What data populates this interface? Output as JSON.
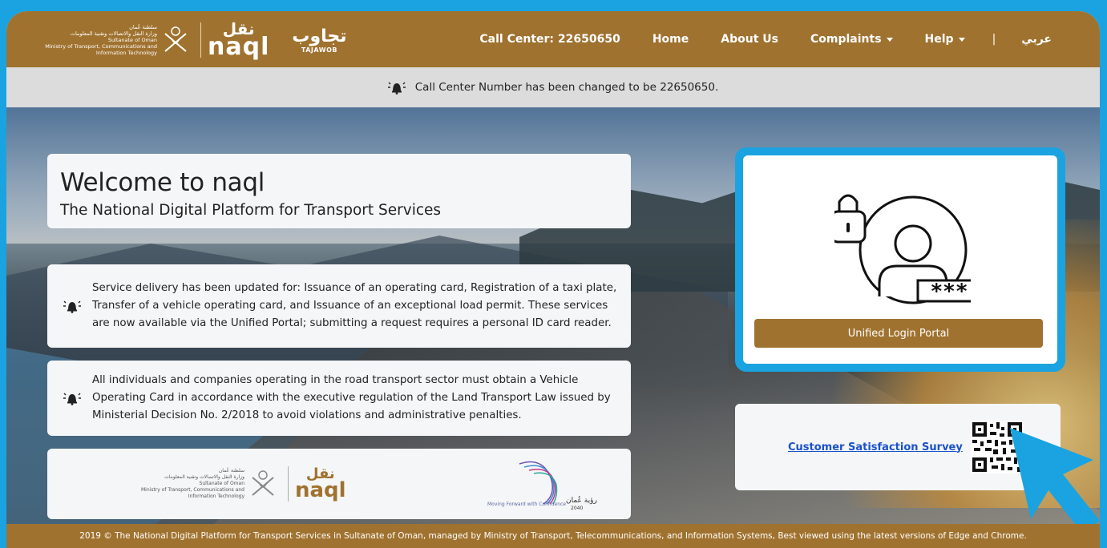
{
  "header": {
    "ministry_text_ar_1": "سلطنة عُمان",
    "ministry_text_ar_2": "وزارة النقل والاتصالات وتقنية المعلومات",
    "ministry_text_en_1": "Sultanate of Oman",
    "ministry_text_en_2": "Ministry of Transport, Communications and",
    "ministry_text_en_3": "Information Technology",
    "naql_ar": "نقل",
    "naql_en": "naql",
    "tajawob_ar": "تجاوب",
    "tajawob_en": "TAJAWOB",
    "nav": {
      "call_center": "Call Center: 22650650",
      "home": "Home",
      "about": "About Us",
      "complaints": "Complaints",
      "help": "Help",
      "separator": "|",
      "language": "عربي"
    },
    "color": "#a0722f"
  },
  "notice": {
    "text": "Call Center Number has been changed to be 22650650."
  },
  "welcome": {
    "title": "Welcome to naql",
    "subtitle": "The National Digital Platform for Transport Services"
  },
  "news": [
    {
      "text": "Service delivery has been updated for: Issuance of an operating card, Registration of a taxi plate, Transfer of a vehicle operating card, and Issuance of an exceptional load permit. These services are now available via the Unified Portal; submitting a request requires a personal ID card reader."
    },
    {
      "text": "All individuals and companies operating in the road transport sector must obtain a Vehicle Operating Card in accordance with the executive regulation of the Land Transport Law issued by Ministerial Decision No. 2/2018 to avoid violations and administrative penalties."
    }
  ],
  "logos": {
    "vision_ar": "رؤية عُمان",
    "vision_year": "2040",
    "vision_en": "Moving Forward with Confidence"
  },
  "login": {
    "icon": "user-lock-password-icon",
    "button": "Unified Login Portal"
  },
  "survey": {
    "link": "Customer Satisfaction Survey"
  },
  "footer": {
    "text": "2019 © The National Digital Platform for Transport Services in Sultanate of Oman, managed by Ministry of Transport, Telecommunications, and Information Systems, Best viewed using the latest versions of Edge and Chrome."
  },
  "colors": {
    "brand": "#a0722f",
    "highlight": "#1aa3e0",
    "link": "#1a52c9"
  }
}
